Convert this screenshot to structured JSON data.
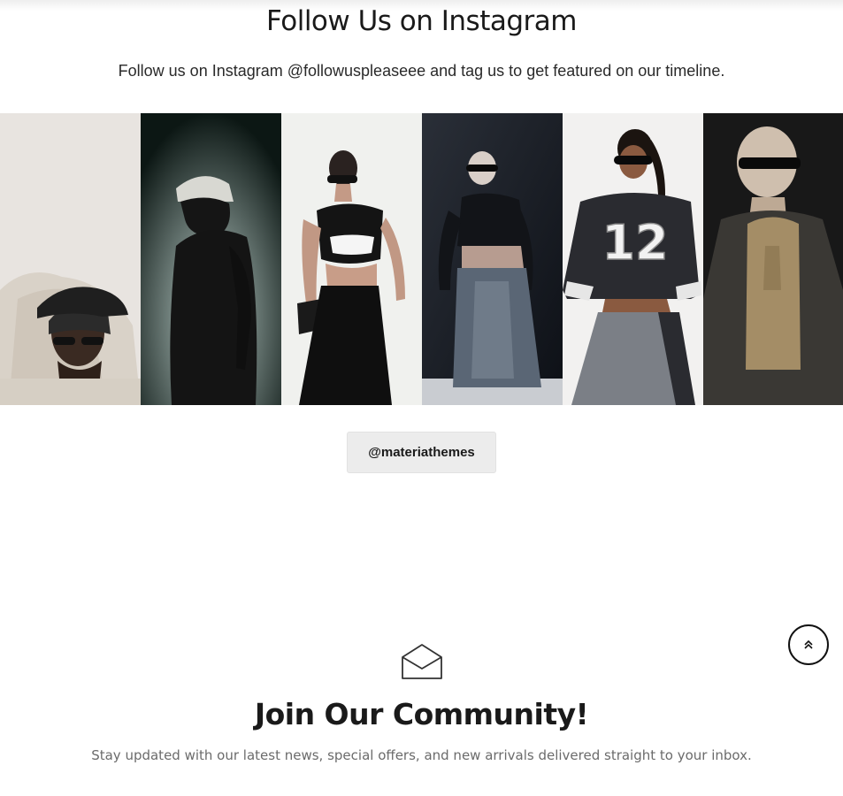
{
  "instagram": {
    "title": "Follow Us on Instagram",
    "subtitle": "Follow us on Instagram @followuspleaseee and tag us to get featured on our timeline.",
    "handle_button": "@materiathemes",
    "gallery": [
      {
        "name": "gallery-image-1",
        "bg": "#e7e3df"
      },
      {
        "name": "gallery-image-2",
        "bg": "#0d1815"
      },
      {
        "name": "gallery-image-3",
        "bg": "#f1f2ef"
      },
      {
        "name": "gallery-image-4",
        "bg": "#1c1f25"
      },
      {
        "name": "gallery-image-5",
        "bg": "#f2f1f0"
      },
      {
        "name": "gallery-image-6",
        "bg": "#161616"
      }
    ],
    "jersey_number": "12"
  },
  "scroll_top": {
    "icon": "double-chevron-up-icon"
  },
  "community": {
    "icon": "envelope-open-icon",
    "title": "Join Our Community!",
    "subtitle": "Stay updated with our latest news, special offers, and new arrivals delivered straight to your inbox."
  }
}
